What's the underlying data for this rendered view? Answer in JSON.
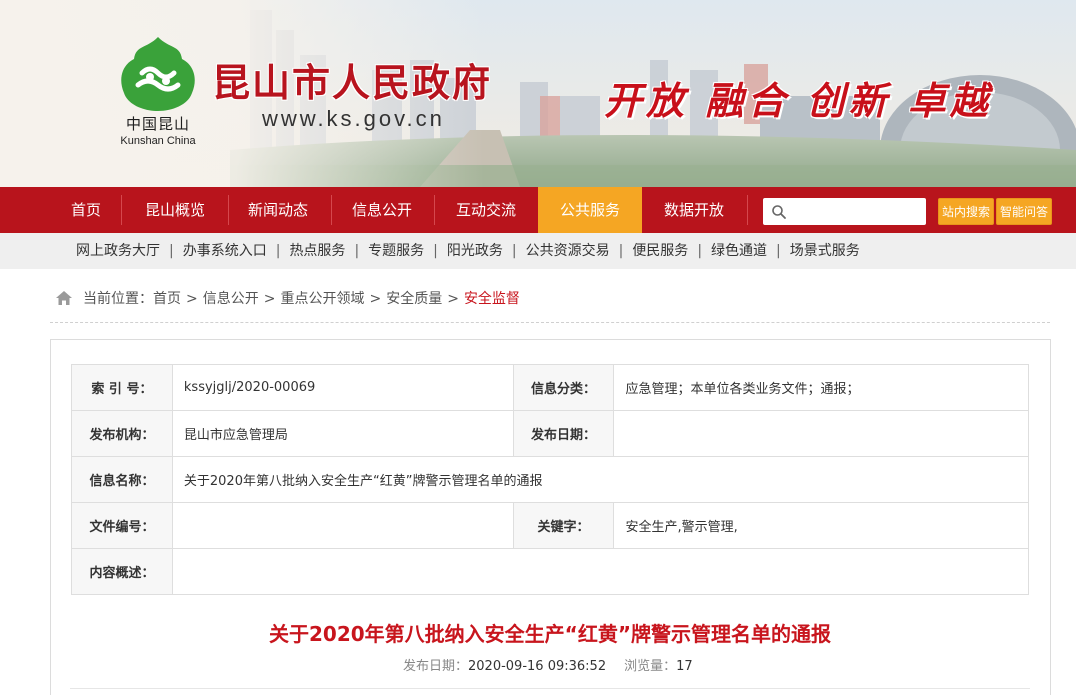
{
  "header": {
    "title": "昆山市人民政府",
    "url": "www.ks.gov.cn",
    "slogan": "开放 融合 创新 卓越",
    "logo_cn": "中国昆山",
    "logo_en": "Kunshan China"
  },
  "nav": {
    "items": [
      "首页",
      "昆山概览",
      "新闻动态",
      "信息公开",
      "互动交流",
      "公共服务",
      "数据开放"
    ],
    "active": "公共服务",
    "search_placeholder": "",
    "search_button": "站内搜索",
    "qa_button": "智能问答"
  },
  "subnav": {
    "items": [
      "网上政务大厅",
      "办事系统入口",
      "热点服务",
      "专题服务",
      "阳光政务",
      "公共资源交易",
      "便民服务",
      "绿色通道",
      "场景式服务"
    ]
  },
  "breadcrumb": {
    "prefix": "当前位置：",
    "items": [
      "首页",
      "信息公开",
      "重点公开领域",
      "安全质量"
    ],
    "current": "安全监督"
  },
  "info": {
    "index_label": "索 引 号：",
    "index_value": "kssyjglj/2020-00069",
    "category_label": "信息分类：",
    "category_value": "应急管理；本单位各类业务文件；通报；",
    "org_label": "发布机构：",
    "org_value": "昆山市应急管理局",
    "date_label": "发布日期：",
    "date_value": "",
    "name_label": "信息名称：",
    "name_value": "关于2020年第八批纳入安全生产“红黄”牌警示管理名单的通报",
    "docno_label": "文件编号：",
    "docno_value": "",
    "keyword_label": "关键字：",
    "keyword_value": "安全生产,警示管理,",
    "summary_label": "内容概述：",
    "summary_value": ""
  },
  "article": {
    "title": "关于2020年第八批纳入安全生产“红黄”牌警示管理名单的通报",
    "date_label": "发布日期：",
    "date_value": "2020-09-16 09:36:52",
    "views_label": "浏览量：",
    "views_value": "17"
  },
  "colors": {
    "nav_red": "#b8141c",
    "accent_orange": "#f5a623",
    "title_red": "#c8151d"
  }
}
